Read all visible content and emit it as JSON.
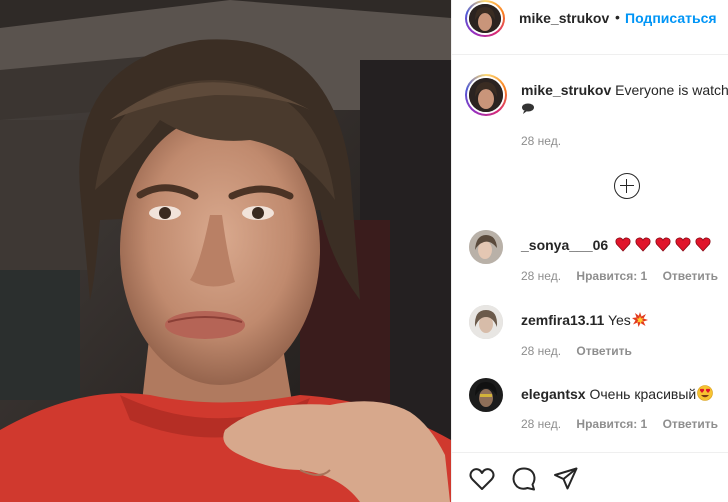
{
  "post": {
    "author": "mike_strukov",
    "follow_label": "Подписаться",
    "dot": "•",
    "caption_text": "Everyone is watch",
    "caption_time": "28 нед."
  },
  "comments": [
    {
      "user": "_sonya___06",
      "text": "",
      "emoji": "heart x5",
      "time": "28 нед.",
      "likes": "Нравится: 1",
      "reply": "Ответить"
    },
    {
      "user": "zemfira13.11",
      "text": "Yes",
      "emoji": "collision",
      "time": "28 нед.",
      "reply": "Ответить"
    },
    {
      "user": "elegantsx",
      "text": "Очень красивый",
      "emoji": "heart-eyes",
      "time": "28 нед.",
      "likes": "Нравится: 1",
      "reply": "Ответить"
    }
  ],
  "icons": {
    "load_more": "plus-circle-icon",
    "like": "heart-outline-icon",
    "comment": "comment-bubble-icon",
    "share": "paper-plane-icon"
  },
  "colors": {
    "link_blue": "#0095f6",
    "text": "#262626",
    "muted": "#8e8e8e",
    "heart_red": "#e0142a"
  }
}
